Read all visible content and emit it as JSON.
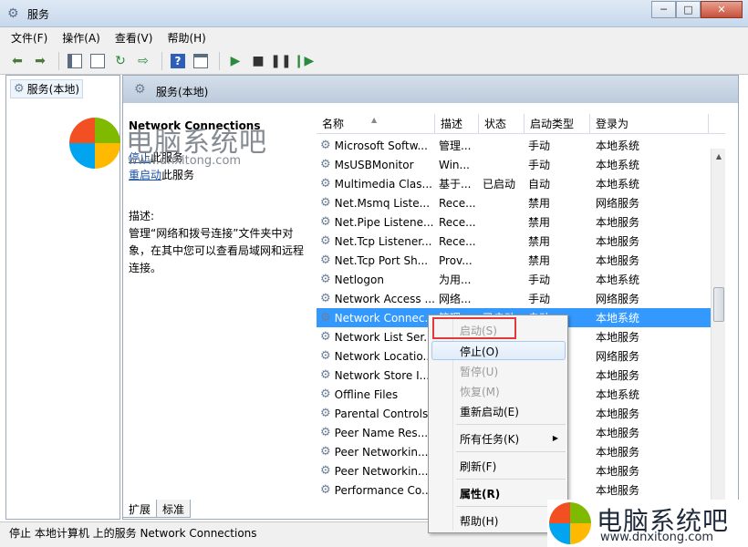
{
  "window": {
    "title": "服务",
    "minimize": "─",
    "maximize": "□",
    "close": "✕"
  },
  "menu": [
    "文件(F)",
    "操作(A)",
    "查看(V)",
    "帮助(H)"
  ],
  "toolbar": {
    "icons": [
      "back-arrow-icon",
      "forward-arrow-icon",
      "show-hide-tree-icon",
      "properties-icon",
      "refresh-icon",
      "export-list-icon",
      "help-icon",
      "view-icon",
      "start-service-icon",
      "stop-service-icon",
      "pause-service-icon",
      "restart-service-icon"
    ]
  },
  "tree": {
    "item": "服务(本地)"
  },
  "header": {
    "title": "服务(本地)"
  },
  "detail": {
    "service_name": "Network Connections",
    "stop_link": "停止",
    "stop_suffix": "此服务",
    "restart_link": "重启动",
    "restart_suffix": "此服务",
    "desc_label": "描述:",
    "desc_text": "管理“网络和拨号连接”文件夹中对象，在其中您可以查看局域网和远程连接。"
  },
  "columns": [
    "名称",
    "描述",
    "状态",
    "启动类型",
    "登录为"
  ],
  "services": [
    {
      "name": "Microsoft Softw...",
      "desc": "管理...",
      "status": "",
      "start": "手动",
      "logon": "本地系统"
    },
    {
      "name": "MsUSBMonitor",
      "desc": "Win...",
      "status": "",
      "start": "手动",
      "logon": "本地系统"
    },
    {
      "name": "Multimedia Clas...",
      "desc": "基于...",
      "status": "已启动",
      "start": "自动",
      "logon": "本地系统"
    },
    {
      "name": "Net.Msmq Liste...",
      "desc": "Rece...",
      "status": "",
      "start": "禁用",
      "logon": "网络服务"
    },
    {
      "name": "Net.Pipe Listene...",
      "desc": "Rece...",
      "status": "",
      "start": "禁用",
      "logon": "本地服务"
    },
    {
      "name": "Net.Tcp Listener...",
      "desc": "Rece...",
      "status": "",
      "start": "禁用",
      "logon": "本地服务"
    },
    {
      "name": "Net.Tcp Port Sh...",
      "desc": "Prov...",
      "status": "",
      "start": "禁用",
      "logon": "本地服务"
    },
    {
      "name": "Netlogon",
      "desc": "为用...",
      "status": "",
      "start": "手动",
      "logon": "本地系统"
    },
    {
      "name": "Network Access ...",
      "desc": "网络...",
      "status": "",
      "start": "手动",
      "logon": "网络服务"
    },
    {
      "name": "Network Connec...",
      "desc": "管理",
      "status": "已启动",
      "start": "自动",
      "logon": "本地系统"
    },
    {
      "name": "Network List Ser...",
      "desc": "",
      "status": "",
      "start": "",
      "logon": "本地服务"
    },
    {
      "name": "Network Locatio...",
      "desc": "",
      "status": "",
      "start": "",
      "logon": "网络服务"
    },
    {
      "name": "Network Store I...",
      "desc": "",
      "status": "",
      "start": "",
      "logon": "本地服务"
    },
    {
      "name": "Offline Files",
      "desc": "",
      "status": "",
      "start": "",
      "logon": "本地系统"
    },
    {
      "name": "Parental Controls",
      "desc": "",
      "status": "",
      "start": "",
      "logon": "本地服务"
    },
    {
      "name": "Peer Name Res...",
      "desc": "",
      "status": "",
      "start": "",
      "logon": "本地服务"
    },
    {
      "name": "Peer Networkin...",
      "desc": "",
      "status": "",
      "start": "",
      "logon": "本地服务"
    },
    {
      "name": "Peer Networkin...",
      "desc": "",
      "status": "",
      "start": "",
      "logon": "本地服务"
    },
    {
      "name": "Performance Co...",
      "desc": "",
      "status": "",
      "start": "",
      "logon": "本地服务"
    }
  ],
  "context_menu": {
    "start": "启动(S)",
    "stop": "停止(O)",
    "pause": "暂停(U)",
    "resume": "恢复(M)",
    "restart": "重新启动(E)",
    "all_tasks": "所有任务(K)",
    "refresh": "刷新(F)",
    "properties": "属性(R)",
    "help": "帮助(H)"
  },
  "tabs": [
    "扩展",
    "标准"
  ],
  "statusbar": "停止 本地计算机 上的服务 Network Connections",
  "watermark": {
    "brand": "电脑系统吧",
    "url": "www.dnxitong.com",
    "colors": [
      "#f25022",
      "#7fba00",
      "#00a4ef",
      "#ffb900"
    ]
  },
  "colors": {
    "selection": "#3399ff",
    "highlight_box": "#e03a3a",
    "link": "#1a4fa8"
  }
}
